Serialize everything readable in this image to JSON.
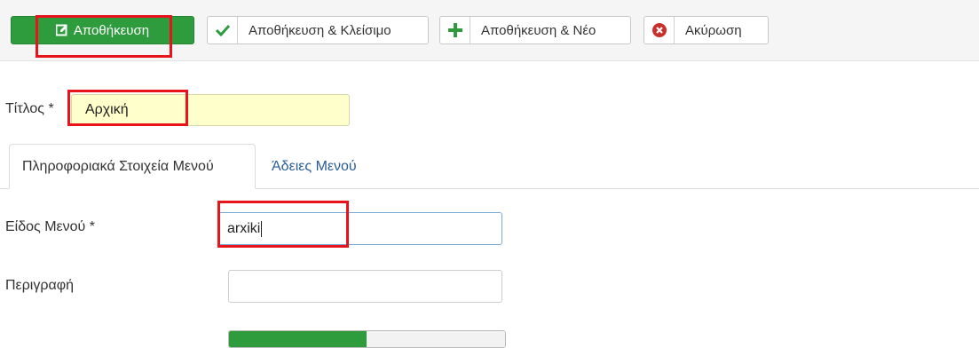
{
  "toolbar": {
    "save": "Αποθήκευση",
    "save_close": "Αποθήκευση & Κλείσιμο",
    "save_new": "Αποθήκευση & Νέο",
    "cancel": "Ακύρωση"
  },
  "form": {
    "title_label": "Τίτλος *",
    "title_value": "Αρχική",
    "menu_type_label": "Είδος Μενού *",
    "menu_type_value": "arxiki",
    "description_label": "Περιγραφή",
    "description_value": ""
  },
  "tabs": [
    {
      "label": "Πληροφοριακά Στοιχεία Μενού",
      "active": true
    },
    {
      "label": "Άδειες Μενού",
      "active": false
    }
  ],
  "colors": {
    "save_green": "#2e9b3c",
    "highlight_red": "#e8141b",
    "title_bg": "#ffffcc",
    "link_blue": "#2a5d96",
    "cancel_red": "#c9302c"
  }
}
